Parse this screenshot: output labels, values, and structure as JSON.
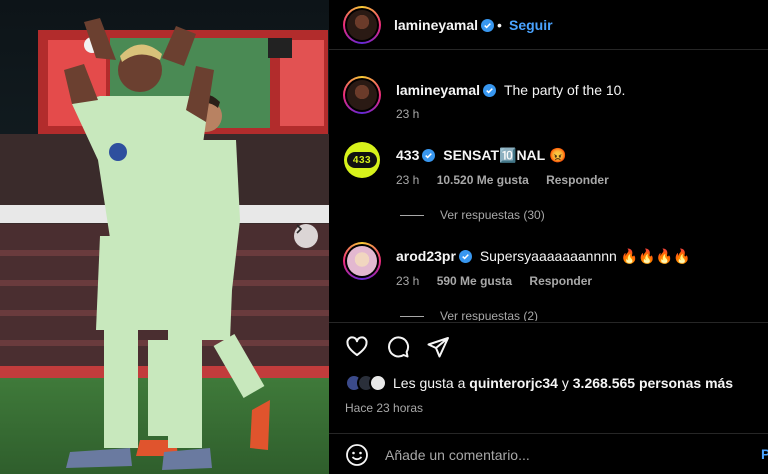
{
  "header": {
    "username": "lamineyamal",
    "separator": "•",
    "follow_label": "Seguir"
  },
  "caption": {
    "username": "lamineyamal",
    "text": "The party of the 10.",
    "time": "23 h"
  },
  "comments": [
    {
      "username": "433",
      "avatar_text": "433",
      "text_before": "SENSAT",
      "emoji_inline": "🔟",
      "text_after": "NAL",
      "emoji_end": "😡",
      "time": "23 h",
      "likes": "10.520 Me gusta",
      "reply_label": "Responder",
      "view_replies": "Ver respuestas (30)"
    },
    {
      "username": "arod23pr",
      "text": "Supersyaaaaaaannnn 🔥🔥🔥🔥",
      "time": "23 h",
      "likes": "590 Me gusta",
      "reply_label": "Responder",
      "view_replies": "Ver respuestas (2)"
    }
  ],
  "actions": {
    "like_icon": "heart-icon",
    "comment_icon": "comment-icon",
    "share_icon": "send-icon"
  },
  "likes": {
    "prefix": "Les gusta a",
    "user": "quinterorjc34",
    "connector": "y",
    "others": "3.268.565 personas más"
  },
  "posted": "Hace 23 horas",
  "comment_box": {
    "placeholder": "Añade un comentario...",
    "post_label": "P"
  },
  "colors": {
    "accent": "#4aa3ff",
    "verified": "#3897f0",
    "muted": "#a8a8a8",
    "kit": "#c8e8bd"
  }
}
